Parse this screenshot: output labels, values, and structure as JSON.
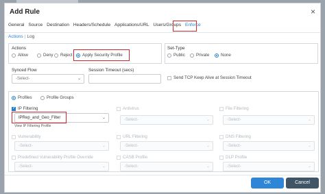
{
  "dialog": {
    "title": "Add Rule",
    "close_glyph": "×"
  },
  "tabs": [
    {
      "label": "General"
    },
    {
      "label": "Source"
    },
    {
      "label": "Destination"
    },
    {
      "label": "Headers/Schedule"
    },
    {
      "label": "Applications/URL"
    },
    {
      "label": "Users/Groups"
    },
    {
      "label": "Enforce"
    }
  ],
  "subtabs": {
    "actions": "Actions",
    "separator": "|",
    "log": "Log"
  },
  "actions": {
    "label": "Actions",
    "options": [
      "Allow",
      "Deny",
      "Reject",
      "Apply Security Profile"
    ],
    "selected": "Apply Security Profile"
  },
  "settype": {
    "label": "Set-Type",
    "options": [
      "Public",
      "Private",
      "None"
    ],
    "selected": "None"
  },
  "synced_flow": {
    "label": "Synced Flow",
    "value": "-Select-"
  },
  "session_timeout": {
    "label": "Session Timeout (secs)",
    "value": ""
  },
  "tcp_keepalive": {
    "label": "Send TCP Keep Alive at Session Timeout"
  },
  "profile_mode": {
    "options": [
      "Profiles",
      "Profile Groups"
    ],
    "selected": "Profiles"
  },
  "profiles": {
    "ip_filtering": {
      "label": "IP Filtering",
      "value": "IPRep_and_Geo_Filter",
      "hint": "View IP Filtering Profile"
    },
    "antivirus": {
      "label": "Antivirus",
      "value": "-Select-"
    },
    "file_filtering": {
      "label": "File Filtering",
      "value": "-Select-"
    },
    "vulnerability": {
      "label": "Vulnerability",
      "value": "-Select-"
    },
    "url_filtering": {
      "label": "URL Filtering",
      "value": "-Select-"
    },
    "dns_filtering": {
      "label": "DNS Filtering",
      "value": "-Select-"
    },
    "pvpo": {
      "label": "Predefined Vulnerability Profile Override",
      "value": "-Select-"
    },
    "casb": {
      "label": "CASB Profile",
      "value": "-Select-"
    },
    "dlp": {
      "label": "DLP Profile",
      "value": "-Select-"
    }
  },
  "buttons": {
    "ok": "OK",
    "cancel": "Cancel"
  },
  "colors": {
    "accent": "#1f7fd1",
    "highlight": "#d1262a",
    "ok": "#2f86d6",
    "cancel": "#3f5565"
  }
}
